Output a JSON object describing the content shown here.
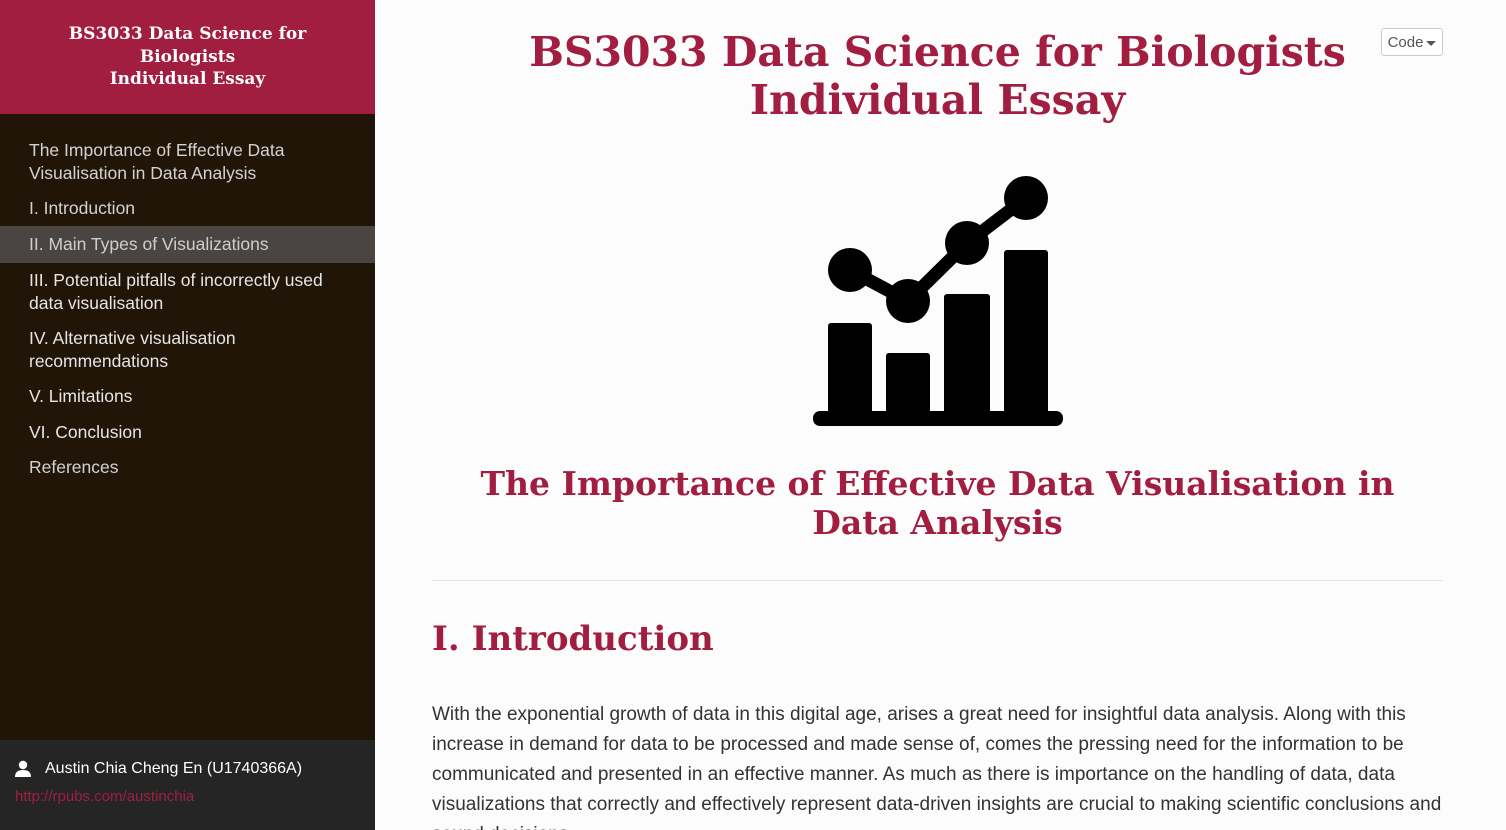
{
  "sidebar": {
    "header_lines": [
      "BS3033 Data Science for",
      "Biologists",
      "Individual Essay"
    ],
    "toc": [
      {
        "label": "The Importance of Effective Data Visualisation in Data Analysis"
      },
      {
        "label": "I. Introduction"
      },
      {
        "label": "II. Main Types of Visualizations",
        "active": true
      },
      {
        "label": "III. Potential pitfalls of incorrectly used data visualisation"
      },
      {
        "label": "IV. Alternative visualisation recommendations"
      },
      {
        "label": "V. Limitations"
      },
      {
        "label": "VI. Conclusion"
      },
      {
        "label": "References"
      }
    ],
    "footer": {
      "author": "Austin Chia Cheng En (U1740366A)",
      "link": "http://rpubs.com/austinchia",
      "icon": "user-icon"
    }
  },
  "toolbar": {
    "code_label": "Code",
    "code_icon": "caret-down-icon"
  },
  "main": {
    "title_line1": "BS3033 Data Science for Biologists",
    "title_line2": "Individual Essay",
    "hero_icon": "bar-line-chart-icon",
    "subtitle": "The Importance of Effective Data Visualisation in Data Analysis",
    "section_heading": "I. Introduction",
    "paragraph": "With the exponential growth of data in this digital age, arises a great need for insightful data analysis. Along with this increase in demand for data to be processed and made sense of, comes the pressing need for the information to be communicated and presented in an effective manner. As much as there is importance on the handling of data, data visualizations that correctly and effectively represent data-driven insights are crucial to making scientific conclusions and sound decisions."
  },
  "colors": {
    "accent": "#a11e41",
    "sidebar_bg": "#211508",
    "sidebar_active": "#4a4542",
    "footer_bg": "#252525"
  }
}
